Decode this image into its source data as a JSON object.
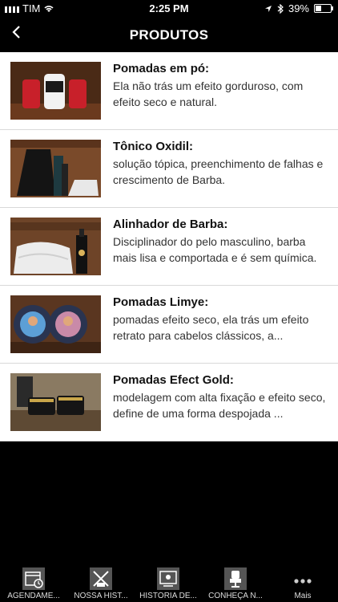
{
  "status": {
    "carrier": "TIM",
    "time": "2:25 PM",
    "battery": "39%",
    "battery_level": 0.39
  },
  "nav": {
    "title": "PRODUTOS",
    "back_icon": "chevron-left-icon"
  },
  "products": [
    {
      "title": "Pomadas em pó:",
      "desc": "Ela não trás um efeito gorduroso, com efeito seco e natural."
    },
    {
      "title": "Tônico Oxidil:",
      "desc": "solução tópica, preenchimento de falhas e crescimento de Barba."
    },
    {
      "title": "Alinhador de Barba:",
      "desc": "Disciplinador do pelo masculino, barba mais lisa e comportada e é sem química."
    },
    {
      "title": "Pomadas Limye:",
      "desc": "pomadas efeito seco, ela trás um efeito retrato para cabelos clássicos, a..."
    },
    {
      "title": "Pomadas Efect Gold:",
      "desc": "modelagem com alta fixação e efeito seco, define de uma forma despojada ..."
    }
  ],
  "tabs": [
    {
      "label": "AGENDAME...",
      "icon": "calendar-icon"
    },
    {
      "label": "NOSSA HIST...",
      "icon": "barber-tools-icon"
    },
    {
      "label": "HISTÓRIA DE...",
      "icon": "certificate-icon"
    },
    {
      "label": "CONHEÇA N...",
      "icon": "barber-chair-icon"
    },
    {
      "label": "Mais",
      "icon": "more-icon"
    }
  ]
}
